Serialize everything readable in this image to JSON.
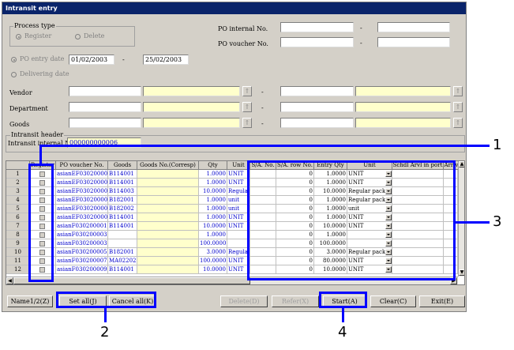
{
  "window": {
    "title": "Intransit entry"
  },
  "process_type": {
    "legend": "Process type",
    "register_label": "Register",
    "delete_label": "Delete"
  },
  "po_internal": {
    "label": "PO internal No.",
    "from": "",
    "to": "",
    "sep": "-"
  },
  "po_voucher": {
    "label": "PO voucher No.",
    "from": "",
    "to": "",
    "sep": "-"
  },
  "po_entry": {
    "label": "PO entry date",
    "from": "01/02/2003",
    "to": "25/02/2003",
    "sep": "-"
  },
  "delivering": {
    "label": "Delivering date"
  },
  "vendor": {
    "label": "Vendor",
    "sep": "-"
  },
  "department": {
    "label": "Department",
    "sep": "-"
  },
  "goods": {
    "label": "Goods",
    "sep": "-"
  },
  "intransit_header": {
    "legend": "Intransit header",
    "label": "Intransit internal No.",
    "value": "000000000006"
  },
  "table": {
    "headers": [
      "Register",
      "PO voucher No.",
      "Goods",
      "Goods No.(Corresp)",
      "Qty",
      "Unit",
      "S/A. No.",
      "S/A. row No.",
      "Entry Qty",
      "Unit",
      "Schdl Arvl in port",
      "Arriv"
    ],
    "rows": [
      {
        "n": "1",
        "po": "asianEF030200001",
        "goods": "B114001",
        "qty": "1.0000",
        "unit": "UNIT",
        "sa": "0",
        "qty2": "1.0000",
        "unit2": "UNIT"
      },
      {
        "n": "2",
        "po": "asianEF030200001",
        "goods": "B114001",
        "qty": "1.0000",
        "unit": "UNIT",
        "sa": "0",
        "qty2": "1.0000",
        "unit2": "UNIT"
      },
      {
        "n": "3",
        "po": "asianEF030200001",
        "goods": "B114003",
        "qty": "10.0000",
        "unit": "Regular",
        "sa": "0",
        "qty2": "10.0000",
        "unit2": "Regular pack"
      },
      {
        "n": "4",
        "po": "asianEF030200001",
        "goods": "B182001",
        "qty": "1.0000",
        "unit": "unit",
        "sa": "0",
        "qty2": "1.0000",
        "unit2": "Regular pack"
      },
      {
        "n": "5",
        "po": "asianEF030200001",
        "goods": "B182002",
        "qty": "1.0000",
        "unit": "unit",
        "sa": "0",
        "qty2": "1.0000",
        "unit2": "unit"
      },
      {
        "n": "6",
        "po": "asianEF030200001",
        "goods": "B114001",
        "qty": "1.0000",
        "unit": "UNIT",
        "sa": "0",
        "qty2": "1.0000",
        "unit2": "UNIT"
      },
      {
        "n": "7",
        "po": "asianF030200001",
        "goods": "B114001",
        "qty": "10.0000",
        "unit": "UNIT",
        "sa": "0",
        "qty2": "10.0000",
        "unit2": "UNIT"
      },
      {
        "n": "8",
        "po": "asianF030200003",
        "goods": "",
        "qty": "1.0000",
        "unit": "",
        "sa": "0",
        "qty2": "1.0000",
        "unit2": ""
      },
      {
        "n": "9",
        "po": "asianF030200003",
        "goods": "",
        "qty": "100.0000",
        "unit": "",
        "sa": "0",
        "qty2": "100.0000",
        "unit2": ""
      },
      {
        "n": "10",
        "po": "asianF030200005",
        "goods": "B182001",
        "qty": "3.0000",
        "unit": "Regular",
        "sa": "0",
        "qty2": "3.0000",
        "unit2": "Regular pack"
      },
      {
        "n": "11",
        "po": "asianF030200007",
        "goods": "MA02202",
        "qty": "100.0000",
        "unit": "UNIT",
        "sa": "0",
        "qty2": "80.0000",
        "unit2": "UNIT"
      },
      {
        "n": "12",
        "po": "asianF030200009",
        "goods": "B114001",
        "qty": "10.0000",
        "unit": "UNIT",
        "sa": "0",
        "qty2": "10.0000",
        "unit2": "UNIT"
      }
    ]
  },
  "buttons": {
    "name": "Name1/2(Z)",
    "set_all": "Set all(J)",
    "cancel_all": "Cancel all(K)",
    "delete": "Delete(D)",
    "refer": "Refer(X)",
    "start": "Start(A)",
    "clear": "Clear(C)",
    "exit": "Exit(E)"
  },
  "callouts": [
    "1",
    "2",
    "3",
    "4"
  ],
  "colors": {
    "highlight": "#0000ff",
    "title_bar": "#0a246a",
    "entry_yellow": "#ffffcc",
    "link_blue": "#0000cc"
  }
}
